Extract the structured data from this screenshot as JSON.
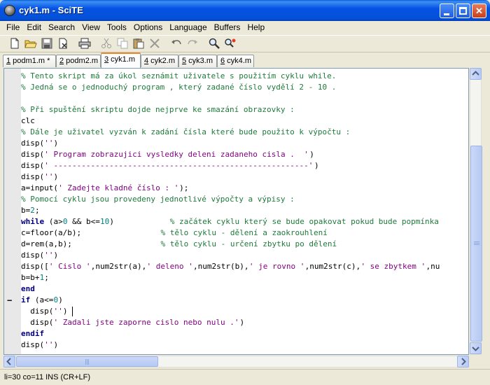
{
  "window": {
    "title": "cyk1.m - SciTE"
  },
  "menu": [
    "File",
    "Edit",
    "Search",
    "View",
    "Tools",
    "Options",
    "Language",
    "Buffers",
    "Help"
  ],
  "toolbar": [
    "new-file-icon",
    "open-file-icon",
    "save-icon",
    "close-file-icon",
    "print-icon",
    "cut-icon",
    "copy-icon",
    "paste-icon",
    "delete-icon",
    "undo-icon",
    "redo-icon",
    "find-icon",
    "replace-icon"
  ],
  "tabs": [
    {
      "num": "1",
      "label": " podm1.m *"
    },
    {
      "num": "2",
      "label": " podm2.m"
    },
    {
      "num": "3",
      "label": " cyk1.m"
    },
    {
      "num": "4",
      "label": " cyk2.m"
    },
    {
      "num": "5",
      "label": " cyk3.m"
    },
    {
      "num": "6",
      "label": " cyk4.m"
    }
  ],
  "active_tab": "3",
  "code_lines": [
    [
      [
        "comment",
        "% Tento skript má za úkol seznámit uživatele s použitím cyklu while."
      ]
    ],
    [
      [
        "comment",
        "% Jedná se o jednoduchý program , který zadané číslo vydělí 2 - 10 ."
      ]
    ],
    [],
    [
      [
        "comment",
        "% Při spuštění skriptu dojde nejprve ke smazání obrazovky :"
      ]
    ],
    [
      [
        "def",
        "clc"
      ]
    ],
    [
      [
        "comment",
        "% Dále je uživatel vyzván k zadání čísla které bude použito k výpočtu :"
      ]
    ],
    [
      [
        "def",
        "disp("
      ],
      [
        "str",
        "''"
      ],
      [
        "def",
        ")"
      ]
    ],
    [
      [
        "def",
        "disp("
      ],
      [
        "str",
        "' Program zobrazujici vysledky deleni zadaneho cisla .  '"
      ],
      [
        "def",
        ")"
      ]
    ],
    [
      [
        "def",
        "disp("
      ],
      [
        "str",
        "' -------------------------------------------------------'"
      ],
      [
        "def",
        ")"
      ]
    ],
    [
      [
        "def",
        "disp("
      ],
      [
        "str",
        "''"
      ],
      [
        "def",
        ")"
      ]
    ],
    [
      [
        "def",
        "a=input("
      ],
      [
        "str",
        "' Zadejte kladné číslo : '"
      ],
      [
        "def",
        ");"
      ]
    ],
    [
      [
        "comment",
        "% Pomocí cyklu jsou provedeny jednotlivé výpočty a výpisy :"
      ]
    ],
    [
      [
        "def",
        "b="
      ],
      [
        "num",
        "2"
      ],
      [
        "def",
        ";"
      ]
    ],
    [
      [
        "kw",
        "while"
      ],
      [
        "def",
        " (a>"
      ],
      [
        "num",
        "0"
      ],
      [
        "def",
        " && b<="
      ],
      [
        "num",
        "10"
      ],
      [
        "def",
        ")            "
      ],
      [
        "comment",
        "% začátek cyklu který se bude opakovat pokud bude popmínka"
      ]
    ],
    [
      [
        "def",
        "c=floor(a/b);                 "
      ],
      [
        "comment",
        "% tělo cyklu - dělení a zaokrouhlení"
      ]
    ],
    [
      [
        "def",
        "d=rem(a,b);                   "
      ],
      [
        "comment",
        "% tělo cyklu - určení zbytku po dělení"
      ]
    ],
    [
      [
        "def",
        "disp("
      ],
      [
        "str",
        "''"
      ],
      [
        "def",
        ")"
      ]
    ],
    [
      [
        "def",
        "disp(["
      ],
      [
        "str",
        "' Cislo '"
      ],
      [
        "def",
        ",num2str(a),"
      ],
      [
        "str",
        "' deleno '"
      ],
      [
        "def",
        ",num2str(b),"
      ],
      [
        "str",
        "' je rovno '"
      ],
      [
        "def",
        ",num2str(c),"
      ],
      [
        "str",
        "' se zbytkem '"
      ],
      [
        "def",
        ",nu"
      ]
    ],
    [
      [
        "def",
        "b=b+"
      ],
      [
        "num",
        "1"
      ],
      [
        "def",
        ";"
      ]
    ],
    [
      [
        "kw",
        "end"
      ]
    ],
    [
      [
        "kw",
        "if"
      ],
      [
        "def",
        " (a<="
      ],
      [
        "num",
        "0"
      ],
      [
        "def",
        ")"
      ]
    ],
    [
      [
        "def",
        "  disp("
      ],
      [
        "str",
        "''"
      ],
      [
        "def",
        ")"
      ]
    ],
    [
      [
        "def",
        "  disp("
      ],
      [
        "str",
        "' Zadali jste zaporne cislo nebo nulu .'"
      ],
      [
        "def",
        ")"
      ]
    ],
    [
      [
        "kw",
        "endif"
      ]
    ],
    [
      [
        "def",
        "disp("
      ],
      [
        "str",
        "''"
      ],
      [
        "def",
        ")"
      ]
    ]
  ],
  "fold_line": 20,
  "cursor_line": 21,
  "status": {
    "text": "li=30 co=11 INS (CR+LF)"
  },
  "colors": {
    "comment": "#1f7a3a",
    "keyword": "#00007f",
    "string": "#7f007f",
    "number": "#007f7f"
  }
}
